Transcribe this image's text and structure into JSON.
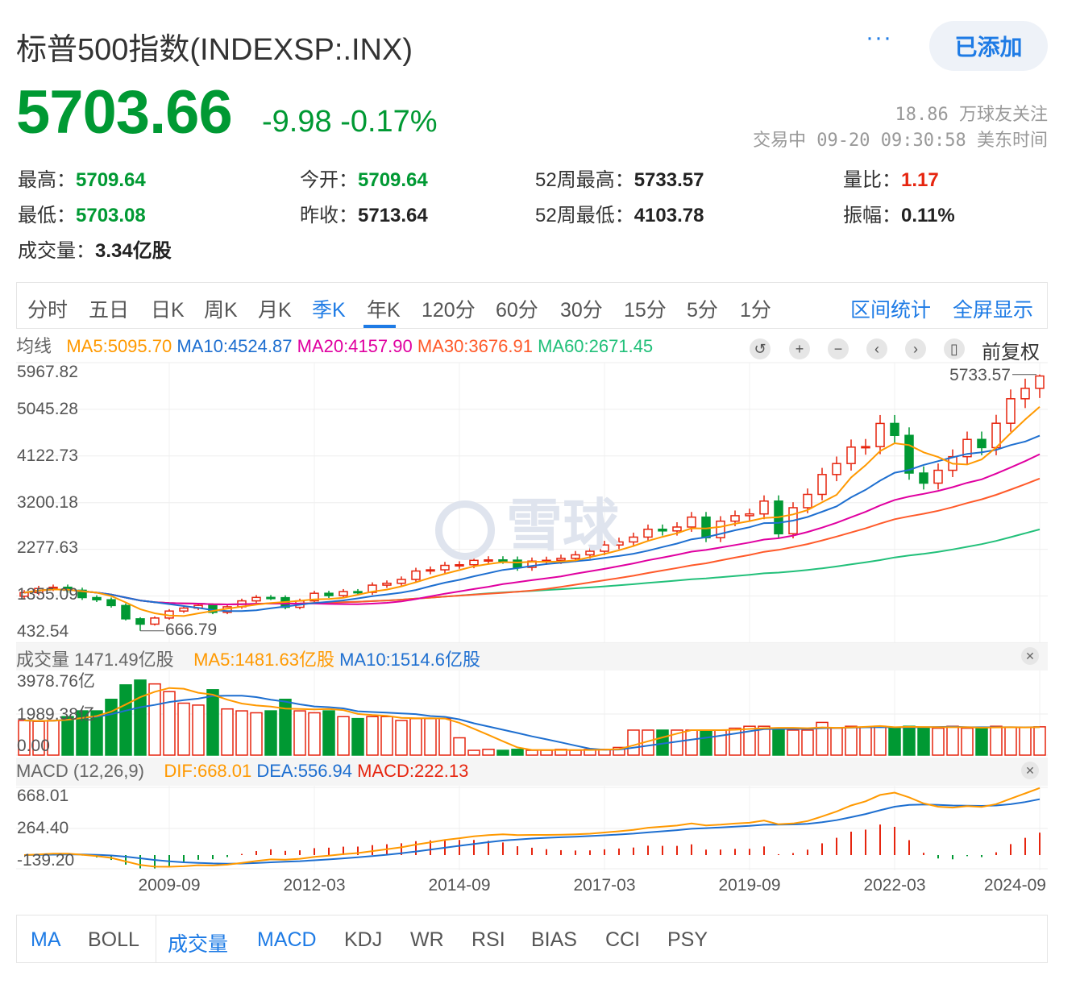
{
  "header": {
    "title": "标普500指数(INDEXSP:.INX)",
    "more": "···",
    "added_button": "已添加",
    "price": "5703.66",
    "change": "-9.98",
    "change_pct": "-0.17%",
    "followers": "18.86 万球友关注",
    "status_time": "交易中 09-20 09:30:58 美东时间"
  },
  "stats": [
    {
      "label": "最高：",
      "value": "5709.64",
      "color": "green"
    },
    {
      "label": "今开：",
      "value": "5709.64",
      "color": "green"
    },
    {
      "label": "52周最高：",
      "value": "5733.57",
      "color": "dark"
    },
    {
      "label": "量比：",
      "value": "1.17",
      "color": "red"
    },
    {
      "label": "最低：",
      "value": "5703.08",
      "color": "green"
    },
    {
      "label": "昨收：",
      "value": "5713.64",
      "color": "dark"
    },
    {
      "label": "52周最低：",
      "value": "4103.78",
      "color": "dark"
    },
    {
      "label": "振幅：",
      "value": "0.11%",
      "color": "dark"
    },
    {
      "label": "成交量：",
      "value": "3.34亿股",
      "color": "dark"
    }
  ],
  "period_tabs": [
    "分时",
    "五日",
    "日K",
    "周K",
    "月K",
    "季K",
    "年K",
    "120分",
    "60分",
    "30分",
    "15分",
    "5分",
    "1分"
  ],
  "active_period": "季K",
  "tools": {
    "range_stats": "区间统计",
    "fullscreen": "全屏显示",
    "adjust": "前复权"
  },
  "ma_legend": {
    "label": "均线",
    "ma5": "MA5:5095.70",
    "ma10": "MA10:4524.87",
    "ma20": "MA20:4157.90",
    "ma30": "MA30:3676.91",
    "ma60": "MA60:2671.45"
  },
  "volume_legend": {
    "label": "成交量 1471.49亿股",
    "ma5": "MA5:1481.63亿股",
    "ma10": "MA10:1514.6亿股"
  },
  "macd_legend": {
    "label": "MACD (12,26,9)",
    "dif": "DIF:668.01",
    "dea": "DEA:556.94",
    "macd": "MACD:222.13"
  },
  "indicator_tabs": [
    "MA",
    "BOLL",
    "成交量",
    "MACD",
    "KDJ",
    "WR",
    "RSI",
    "BIAS",
    "CCI",
    "PSY"
  ],
  "watermark": "雪球",
  "colors": {
    "up": "#e6250f",
    "down": "#009933",
    "ma5": "#ff9900",
    "ma10": "#1e6fd0",
    "ma20": "#e000a0",
    "ma30": "#ff5a2a",
    "ma60": "#22c07a",
    "accent": "#1e7be5"
  },
  "chart_data": {
    "type": "candlestick",
    "period": "quarterly",
    "price_axis": {
      "ticks": [
        "5967.82",
        "5045.28",
        "4122.73",
        "3200.18",
        "2277.63",
        "1355.09",
        "432.54"
      ],
      "range": [
        432.54,
        5967.82
      ]
    },
    "x_ticks": [
      "2009-09",
      "2012-03",
      "2014-09",
      "2017-03",
      "2019-09",
      "2022-03",
      "2024-09"
    ],
    "annotations": {
      "high": "5733.57",
      "low": "666.79"
    },
    "close": [
      1421,
      1503,
      1527,
      1468,
      1323,
      1280,
      1166,
      903,
      798,
      919,
      1057,
      1115,
      1169,
      1031,
      1141,
      1258,
      1326,
      1321,
      1131,
      1258,
      1408,
      1362,
      1441,
      1426,
      1569,
      1606,
      1682,
      1848,
      1872,
      1960,
      1972,
      2059,
      2068,
      2063,
      1920,
      2044,
      2060,
      2099,
      2168,
      2239,
      2363,
      2423,
      2519,
      2674,
      2641,
      2718,
      2914,
      2507,
      2834,
      2942,
      2977,
      3231,
      2585,
      3100,
      3363,
      3756,
      3973,
      4298,
      4308,
      4766,
      4530,
      3785,
      3586,
      3840,
      4109,
      4450,
      4288,
      4770,
      5254,
      5460,
      5703.66
    ],
    "volume_yi": [
      1800,
      1750,
      1800,
      2000,
      2300,
      2300,
      2900,
      3650,
      3900,
      3700,
      3300,
      2700,
      2600,
      3400,
      2400,
      2300,
      2200,
      2300,
      2900,
      2300,
      2200,
      2300,
      2000,
      1900,
      2000,
      2000,
      1800,
      1900,
      1900,
      1900,
      900,
      250,
      300,
      250,
      300,
      250,
      250,
      300,
      250,
      300,
      300,
      400,
      1300,
      1300,
      1300,
      1300,
      1300,
      1300,
      1300,
      1400,
      1500,
      1500,
      1400,
      1300,
      1300,
      1700,
      1400,
      1500,
      1450,
      1500,
      1400,
      1500,
      1450,
      1400,
      1500,
      1400,
      1400,
      1500,
      1450,
      1450,
      1471
    ],
    "volume_axis": {
      "ticks": [
        "3978.76亿",
        "1989.38亿",
        "0.00"
      ],
      "max": 3978.76
    },
    "macd_axis": {
      "ticks": [
        "668.01",
        "264.40",
        "-139.20"
      ]
    }
  }
}
